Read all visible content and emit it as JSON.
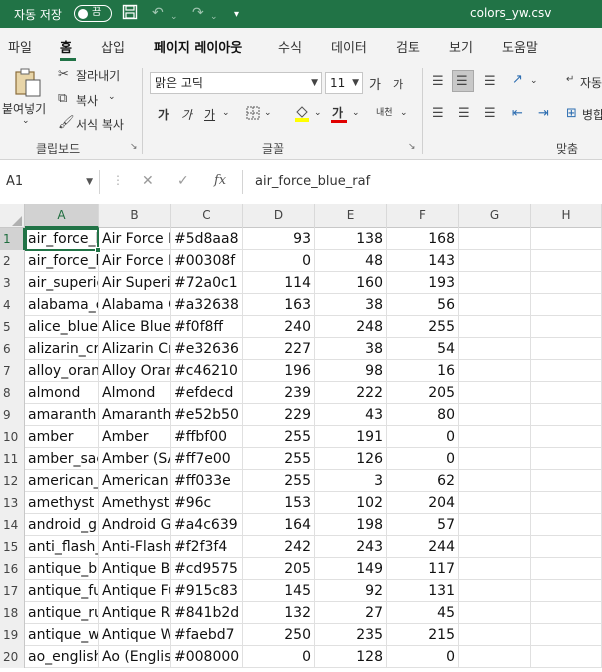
{
  "titlebar": {
    "autosave_label": "자동 저장",
    "autosave_state": "끔",
    "filename": "colors_yw.csv"
  },
  "tabs": [
    {
      "label": "파일"
    },
    {
      "label": "홈"
    },
    {
      "label": "삽입"
    },
    {
      "label": "페이지 레이아웃"
    },
    {
      "label": "수식"
    },
    {
      "label": "데이터"
    },
    {
      "label": "검토"
    },
    {
      "label": "보기"
    },
    {
      "label": "도움말"
    }
  ],
  "ribbon": {
    "paste": "붙여넣기",
    "cut": "잘라내기",
    "copy": "복사",
    "format_painter": "서식 복사",
    "clipboard_group": "클립보드",
    "font_name": "맑은 고딕",
    "font_size": "11",
    "grow_font": "가",
    "shrink_font": "가",
    "bold": "가",
    "italic": "가",
    "underline": "가",
    "font_color": "가",
    "phonetic": "내천",
    "font_group": "글꼴",
    "wrap_text": "자동",
    "merge": "병합",
    "align_group": "맞춤"
  },
  "formula_bar": {
    "name_box": "A1",
    "cancel_icon": "✕",
    "enter_icon": "✓",
    "fx_label": "fx",
    "formula": "air_force_blue_raf"
  },
  "sheet": {
    "columns": [
      "A",
      "B",
      "C",
      "D",
      "E",
      "F",
      "G",
      "H"
    ],
    "rows": [
      {
        "n": "1",
        "a": "air_force_blue_raf",
        "b": "Air Force Blue (RAF)",
        "c": "#5d8aa8",
        "d": "93",
        "e": "138",
        "f": "168"
      },
      {
        "n": "2",
        "a": "air_force_blue_usaf",
        "b": "Air Force Blue (USAF)",
        "c": "#00308f",
        "d": "0",
        "e": "48",
        "f": "143"
      },
      {
        "n": "3",
        "a": "air_superiority_blue",
        "b": "Air Superiority Blue",
        "c": "#72a0c1",
        "d": "114",
        "e": "160",
        "f": "193"
      },
      {
        "n": "4",
        "a": "alabama_crimson",
        "b": "Alabama Crimson",
        "c": "#a32638",
        "d": "163",
        "e": "38",
        "f": "56"
      },
      {
        "n": "5",
        "a": "alice_blue",
        "b": "Alice Blue",
        "c": "#f0f8ff",
        "d": "240",
        "e": "248",
        "f": "255"
      },
      {
        "n": "6",
        "a": "alizarin_crimson",
        "b": "Alizarin Crimson",
        "c": "#e32636",
        "d": "227",
        "e": "38",
        "f": "54"
      },
      {
        "n": "7",
        "a": "alloy_orange",
        "b": "Alloy Orange",
        "c": "#c46210",
        "d": "196",
        "e": "98",
        "f": "16"
      },
      {
        "n": "8",
        "a": "almond",
        "b": "Almond",
        "c": "#efdecd",
        "d": "239",
        "e": "222",
        "f": "205"
      },
      {
        "n": "9",
        "a": "amaranth",
        "b": "Amaranth",
        "c": "#e52b50",
        "d": "229",
        "e": "43",
        "f": "80"
      },
      {
        "n": "10",
        "a": "amber",
        "b": "Amber",
        "c": "#ffbf00",
        "d": "255",
        "e": "191",
        "f": "0"
      },
      {
        "n": "11",
        "a": "amber_sae_ece",
        "b": "Amber (SAE/ECE)",
        "c": "#ff7e00",
        "d": "255",
        "e": "126",
        "f": "0"
      },
      {
        "n": "12",
        "a": "american_rose",
        "b": "American Rose",
        "c": "#ff033e",
        "d": "255",
        "e": "3",
        "f": "62"
      },
      {
        "n": "13",
        "a": "amethyst",
        "b": "Amethyst",
        "c": "#96c",
        "d": "153",
        "e": "102",
        "f": "204"
      },
      {
        "n": "14",
        "a": "android_green",
        "b": "Android Green",
        "c": "#a4c639",
        "d": "164",
        "e": "198",
        "f": "57"
      },
      {
        "n": "15",
        "a": "anti_flash_white",
        "b": "Anti-Flash White",
        "c": "#f2f3f4",
        "d": "242",
        "e": "243",
        "f": "244"
      },
      {
        "n": "16",
        "a": "antique_brass",
        "b": "Antique Brass",
        "c": "#cd9575",
        "d": "205",
        "e": "149",
        "f": "117"
      },
      {
        "n": "17",
        "a": "antique_fuchsia",
        "b": "Antique Fuchsia",
        "c": "#915c83",
        "d": "145",
        "e": "92",
        "f": "131"
      },
      {
        "n": "18",
        "a": "antique_ruby",
        "b": "Antique Ruby",
        "c": "#841b2d",
        "d": "132",
        "e": "27",
        "f": "45"
      },
      {
        "n": "19",
        "a": "antique_white",
        "b": "Antique White",
        "c": "#faebd7",
        "d": "250",
        "e": "235",
        "f": "215"
      },
      {
        "n": "20",
        "a": "ao_english",
        "b": "Ao (English)",
        "c": "#008000",
        "d": "0",
        "e": "128",
        "f": "0"
      }
    ]
  },
  "colors": {
    "accent": "#217346",
    "titlebar": "#217346",
    "ribbon_bg": "#f3f3f3"
  }
}
